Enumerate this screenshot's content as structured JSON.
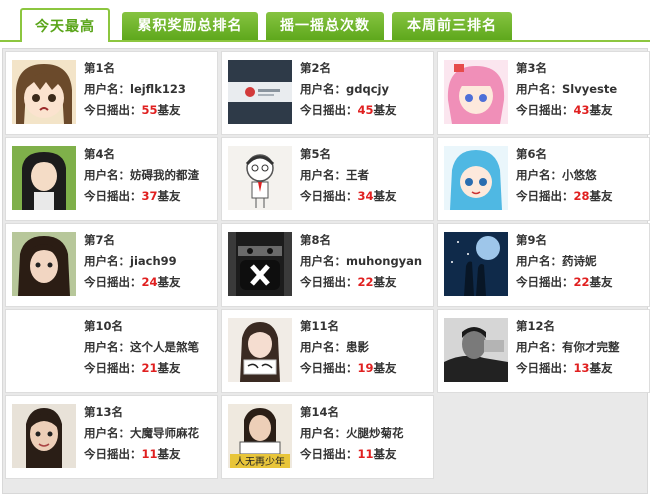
{
  "tabs": [
    {
      "label": "今天最高"
    },
    {
      "label": "累积奖励总排名"
    },
    {
      "label": "摇一摇总次数"
    },
    {
      "label": "本周前三排名"
    }
  ],
  "labels": {
    "user": "用户名：",
    "today": "今日摇出：",
    "unit": "基友"
  },
  "entries": [
    {
      "rank": "第1名",
      "user": "lejflk123",
      "count": "55"
    },
    {
      "rank": "第2名",
      "user": "gdqcjy",
      "count": "45"
    },
    {
      "rank": "第3名",
      "user": "Slvyeste",
      "count": "43"
    },
    {
      "rank": "第4名",
      "user": "妨碍我的都渣",
      "count": "37"
    },
    {
      "rank": "第5名",
      "user": "王者",
      "count": "34"
    },
    {
      "rank": "第6名",
      "user": "小悠悠",
      "count": "28"
    },
    {
      "rank": "第7名",
      "user": "jiach99",
      "count": "24"
    },
    {
      "rank": "第8名",
      "user": "muhongyan",
      "count": "22"
    },
    {
      "rank": "第9名",
      "user": "药诗妮",
      "count": "22"
    },
    {
      "rank": "第10名",
      "user": "这个人是煞笔",
      "count": "21"
    },
    {
      "rank": "第11名",
      "user": "患影",
      "count": "19"
    },
    {
      "rank": "第12名",
      "user": "有你才完整",
      "count": "13"
    },
    {
      "rank": "第13名",
      "user": "大魔导师麻花",
      "count": "11"
    },
    {
      "rank": "第14名",
      "user": "火腿炒菊花",
      "count": "11"
    }
  ],
  "avatar_captions": {
    "entry14": "人无再少年"
  },
  "colors": {
    "accent": "#8cc63f",
    "count": "#e02020"
  }
}
